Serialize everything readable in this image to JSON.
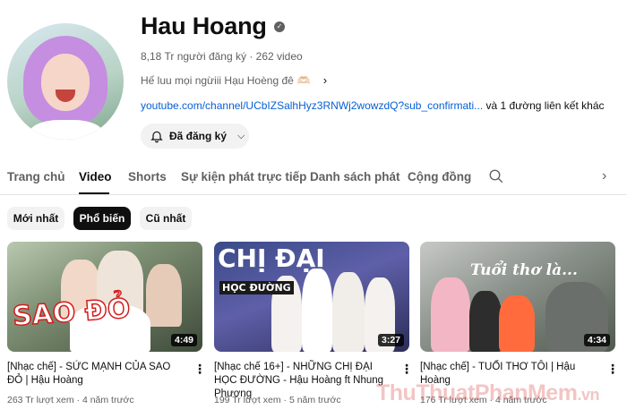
{
  "channel": {
    "name": "Hau Hoang",
    "subscribers": "8,18 Tr người đăng ký",
    "video_count": "262 video",
    "meta_separator": "·",
    "description": "Hế luu mọi ngừiii Hạu Hoèng đê",
    "description_emoji": "🫶🏻",
    "link_url": "youtube.com/channel/UCbIZSalhHyz3RNWj2wowzdQ?sub_confirmati...",
    "link_more": "và 1 đường liên kết khác",
    "subscribe_label": "Đã đăng ký"
  },
  "tabs": [
    {
      "label": "Trang chủ",
      "active": false
    },
    {
      "label": "Video",
      "active": true
    },
    {
      "label": "Shorts",
      "active": false
    },
    {
      "label": "Sự kiện phát trực tiếp",
      "active": false
    },
    {
      "label": "Danh sách phát",
      "active": false
    },
    {
      "label": "Cộng đồng",
      "active": false
    }
  ],
  "filters": [
    {
      "label": "Mới nhất",
      "active": false
    },
    {
      "label": "Phổ biến",
      "active": true
    },
    {
      "label": "Cũ nhất",
      "active": false
    }
  ],
  "videos": [
    {
      "title": "[Nhạc chế] - SỨC MẠNH CỦA SAO ĐỎ | Hậu Hoàng",
      "duration": "4:49",
      "views": "263 Tr lượt xem",
      "age": "4 năm trước",
      "overlay": "SAO ĐỎ"
    },
    {
      "title": "[Nhạc chế 16+] - NHỮNG CHỊ ĐẠI HỌC ĐƯỜNG - Hậu Hoàng ft Nhung Phương",
      "duration": "3:27",
      "views": "199 Tr lượt xem",
      "age": "5 năm trước",
      "overlay": "CHỊ ĐẠI",
      "overlay_sub": "HỌC ĐƯỜNG"
    },
    {
      "title": "[Nhạc chế] - TUỔI THƠ TÔI | Hậu Hoàng",
      "duration": "4:34",
      "views": "176 Tr lượt xem",
      "age": "4 năm trước",
      "overlay": "Tuổi thơ là..."
    }
  ],
  "watermark": {
    "main": "ThuThuatPhanMem",
    "suffix": ".vn"
  },
  "colors": {
    "link": "#065fd4",
    "chip_active": "#0f0f0f",
    "chip": "#f2f2f2",
    "secondary_text": "#606060"
  }
}
